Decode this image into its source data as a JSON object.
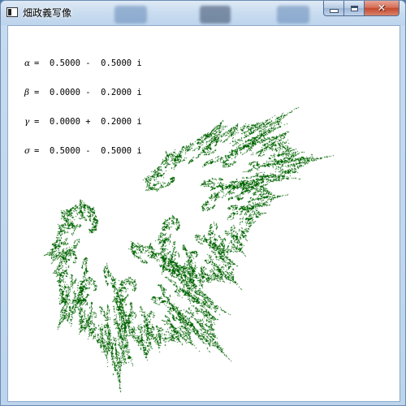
{
  "window": {
    "title": "畑政義写像",
    "icon": "app-window-icon"
  },
  "caption_buttons": {
    "minimize_icon": "minimize-icon",
    "maximize_icon": "maximize-icon",
    "close_icon": "close-icon",
    "close_color": "#c44a2e"
  },
  "parameters": [
    {
      "symbol": "α",
      "value": "=  0.5000 -  0.5000 i"
    },
    {
      "symbol": "β",
      "value": "=  0.0000 -  0.2000 i"
    },
    {
      "symbol": "γ",
      "value": "=  0.0000 +  0.2000 i"
    },
    {
      "symbol": "σ",
      "value": "=  0.5000 -  0.5000 i"
    }
  ],
  "fractal": {
    "color": "#006400",
    "background": "#ffffff"
  }
}
